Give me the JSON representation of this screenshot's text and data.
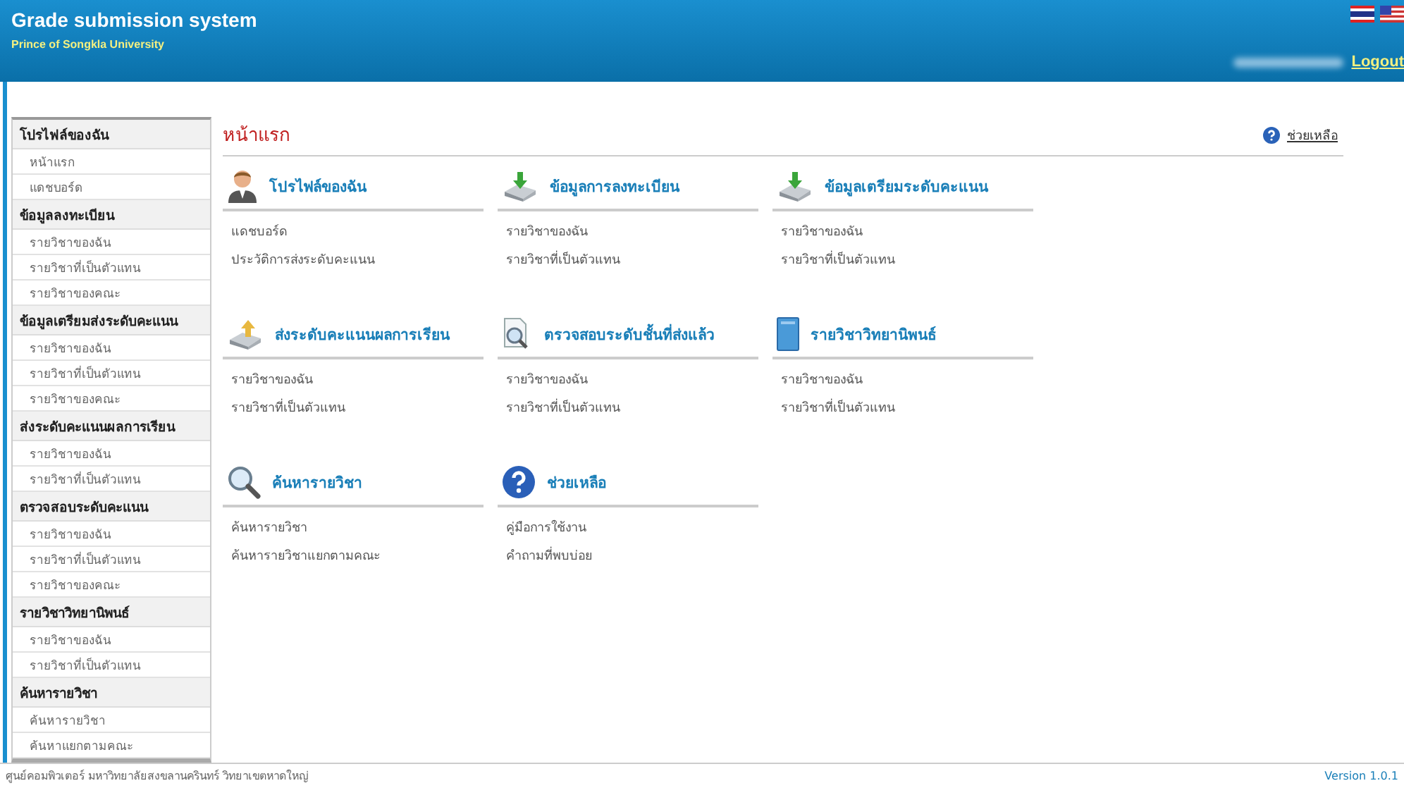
{
  "header": {
    "title": "Grade submission system",
    "subtitle": "Prince of Songkla University",
    "logout": "Logout"
  },
  "sidebar": [
    {
      "title": "โปรไฟล์ของฉัน",
      "items": [
        "หน้าแรก",
        "แดชบอร์ด"
      ]
    },
    {
      "title": "ข้อมูลลงทะเบียน",
      "items": [
        "รายวิชาของฉัน",
        "รายวิชาที่เป็นตัวแทน",
        "รายวิชาของคณะ"
      ]
    },
    {
      "title": "ข้อมูลเตรียมส่งระดับคะแนน",
      "items": [
        "รายวิชาของฉัน",
        "รายวิชาที่เป็นตัวแทน",
        "รายวิชาของคณะ"
      ]
    },
    {
      "title": "ส่งระดับคะแนนผลการเรียน",
      "items": [
        "รายวิชาของฉัน",
        "รายวิชาที่เป็นตัวแทน"
      ]
    },
    {
      "title": "ตรวจสอบระดับคะแนน",
      "items": [
        "รายวิชาของฉัน",
        "รายวิชาที่เป็นตัวแทน",
        "รายวิชาของคณะ"
      ]
    },
    {
      "title": "รายวิชาวิทยานิพนธ์",
      "items": [
        "รายวิชาของฉัน",
        "รายวิชาที่เป็นตัวแทน"
      ]
    },
    {
      "title": "ค้นหารายวิชา",
      "items": [
        "ค้นหารายวิชา",
        "ค้นหาแยกตามคณะ"
      ]
    }
  ],
  "page_title": "หน้าแรก",
  "help_link": "ช่วยเหลือ",
  "sections": [
    {
      "kind": "person",
      "title": "โปรไฟล์ของฉัน",
      "links": [
        "แดชบอร์ด",
        "ประวัติการส่งระดับคะแนน"
      ]
    },
    {
      "kind": "download",
      "title": "ข้อมูลการลงทะเบียน",
      "links": [
        "รายวิชาของฉัน",
        "รายวิชาที่เป็นตัวแทน"
      ]
    },
    {
      "kind": "download",
      "title": "ข้อมูลเตรียมระดับคะแนน",
      "links": [
        "รายวิชาของฉัน",
        "รายวิชาที่เป็นตัวแทน"
      ]
    },
    {
      "kind": "upload",
      "title": "ส่งระดับคะแนนผลการเรียน",
      "links": [
        "รายวิชาของฉัน",
        "รายวิชาที่เป็นตัวแทน"
      ]
    },
    {
      "kind": "review",
      "title": "ตรวจสอบระดับชั้นที่ส่งแล้ว",
      "links": [
        "รายวิชาของฉัน",
        "รายวิชาที่เป็นตัวแทน"
      ]
    },
    {
      "kind": "thesis",
      "title": "รายวิชาวิทยานิพนธ์",
      "links": [
        "รายวิชาของฉัน",
        "รายวิชาที่เป็นตัวแทน"
      ]
    },
    {
      "kind": "search",
      "title": "ค้นหารายวิชา",
      "links": [
        "ค้นหารายวิชา",
        "ค้นหารายวิชาแยกตามคณะ"
      ]
    },
    {
      "kind": "help",
      "title": "ช่วยเหลือ",
      "links": [
        "คู่มือการใช้งาน",
        "คำถามที่พบบ่อย"
      ]
    }
  ],
  "footer": {
    "left": "ศูนย์คอมพิวเตอร์ มหาวิทยาลัยสงขลานครินทร์ วิทยาเขตหาดใหญ่",
    "version": "Version 1.0.1"
  }
}
